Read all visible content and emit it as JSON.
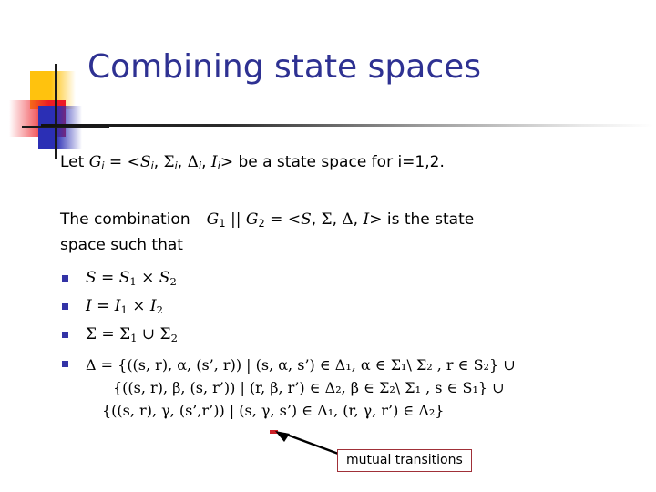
{
  "slide": {
    "title": "Combining state spaces",
    "intro": {
      "prefix": "Let ",
      "g": "G",
      "g_sub": "i",
      "eq": " = <",
      "tuple": [
        {
          "sym": "S",
          "sub": "i"
        },
        {
          "sym": "Σ",
          "sub": "i"
        },
        {
          "sym": "Δ",
          "sub": "i"
        },
        {
          "sym": "I",
          "sub": "i"
        }
      ],
      "suffix": "> be a state space for i=1,2."
    },
    "combination": {
      "lead": "The combination",
      "g1": "G",
      "g1_sub": "1",
      "parallel": " || ",
      "g2": "G",
      "g2_sub": "2",
      "eq": " = <",
      "tuple": [
        "S",
        "Σ",
        "Δ",
        "I"
      ],
      "tail": "> is the state",
      "line2": "space such that"
    },
    "bullets": [
      {
        "id": "states",
        "text": "S = S₁ × S₂",
        "lhs": "S",
        "rhs_a": "S",
        "rhs_a_sub": "1",
        "op": " × ",
        "rhs_b": "S",
        "rhs_b_sub": "2"
      },
      {
        "id": "initial",
        "text": "I = I₁ × I₂",
        "lhs": "I",
        "rhs_a": "I",
        "rhs_a_sub": "1",
        "op": " × ",
        "rhs_b": "I",
        "rhs_b_sub": "2"
      },
      {
        "id": "alphabet",
        "text": "Σ = Σ₁ ∪ Σ₂",
        "lhs": "Σ",
        "rhs_a": "Σ",
        "rhs_a_sub": "1",
        "op": " ∪ ",
        "rhs_b": "Σ",
        "rhs_b_sub": "2"
      }
    ],
    "delta": {
      "head": "Δ = {((s, r), α, (s’, r)) | (s, α, s’) ∈ Δ₁, α ∈ Σ₁\\ Σ₂ , r ∈ S₂} ∪",
      "line2": "{((s, r), β, (s, r’)) | (r, β, r’) ∈ Δ₂, β ∈ Σ₂\\ Σ₁ , s ∈ S₁} ∪",
      "line3": "{((s, r), γ, (s’,r’)) | (s, γ, s’) ∈ Δ₁, (r, γ, r’) ∈ Δ₂}"
    },
    "callout": {
      "label": "mutual transitions"
    },
    "colors": {
      "title": "#2E3192",
      "bullet": "#3333A6",
      "callout_border": "#A03038",
      "ornament_yellow": "#FFC20E",
      "ornament_red": "#ED1C24",
      "ornament_blue": "#2B2FB5"
    }
  }
}
